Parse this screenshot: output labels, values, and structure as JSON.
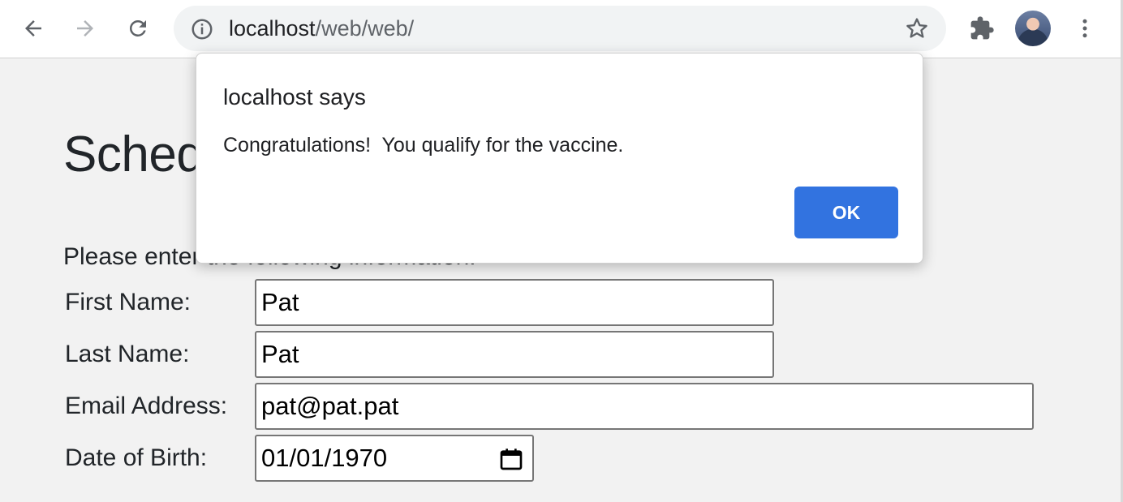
{
  "browser": {
    "url_host": "localhost",
    "url_path": "/web/web/",
    "icons": [
      "back-icon",
      "forward-icon",
      "reload-icon",
      "info-icon",
      "star-icon",
      "extensions-icon",
      "avatar",
      "menu-icon"
    ]
  },
  "page": {
    "heading": "Schedule",
    "intro": "Please enter the following information:",
    "form": {
      "first_name_label": "First Name:",
      "first_name_value": "Pat",
      "last_name_label": "Last Name:",
      "last_name_value": "Pat",
      "email_label": "Email Address:",
      "email_value": "pat@pat.pat",
      "dob_label": "Date of Birth:",
      "dob_value": "01/01/1970"
    }
  },
  "dialog": {
    "title": "localhost says",
    "message": "Congratulations!  You qualify for the vaccine.",
    "ok_label": "OK"
  },
  "colors": {
    "accent": "#3273e0",
    "page_background": "#f2f2f2",
    "omnibox_background": "#f1f3f4"
  }
}
